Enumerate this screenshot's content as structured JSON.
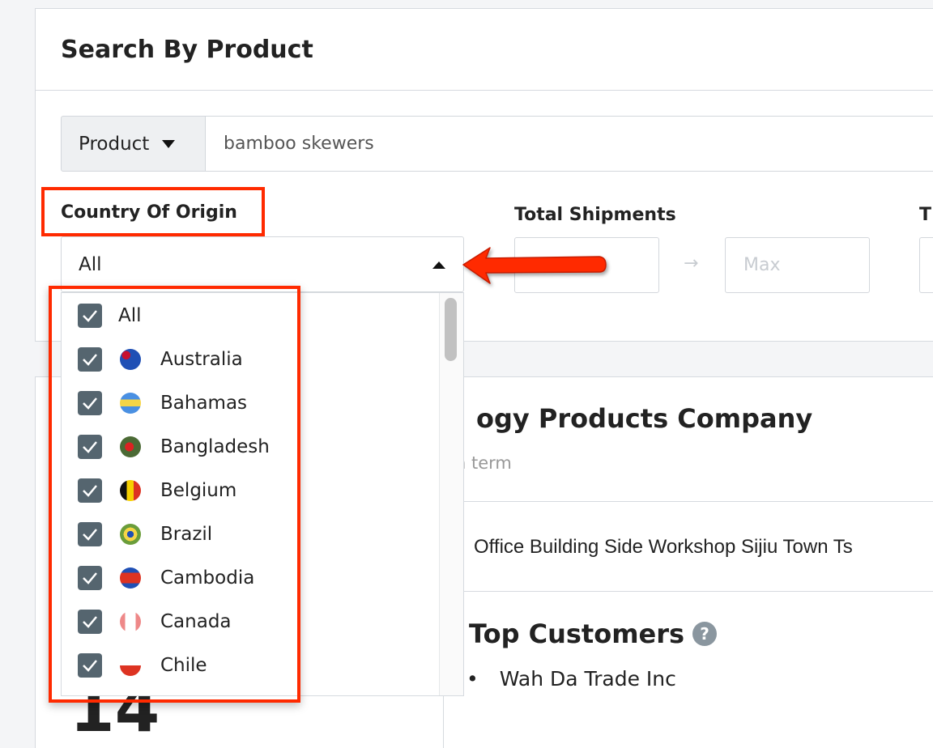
{
  "search_card": {
    "title": "Search By Product",
    "search_type": "Product",
    "query": "bamboo skewers"
  },
  "filters": {
    "country_label": "Country Of Origin",
    "country_value": "All",
    "shipments_label": "Total Shipments",
    "shipments_max_placeholder": "Max",
    "third_label_fragment": "T"
  },
  "country_options": [
    {
      "label": "All",
      "checked": true,
      "flag": null
    },
    {
      "label": "Australia",
      "checked": true,
      "flag": "australia-flag"
    },
    {
      "label": "Bahamas",
      "checked": true,
      "flag": "bahamas-flag"
    },
    {
      "label": "Bangladesh",
      "checked": true,
      "flag": "bangladesh-flag"
    },
    {
      "label": "Belgium",
      "checked": true,
      "flag": "belgium-flag"
    },
    {
      "label": "Brazil",
      "checked": true,
      "flag": "brazil-flag"
    },
    {
      "label": "Cambodia",
      "checked": true,
      "flag": "cambodia-flag"
    },
    {
      "label": "Canada",
      "checked": true,
      "flag": "canada-flag"
    },
    {
      "label": "Chile",
      "checked": true,
      "flag": "chile-flag"
    }
  ],
  "result": {
    "company_fragment": "ogy Products Company",
    "subtitle_fragment": "n term",
    "address_fragment": "Office Building Side Workshop Sijiu Town Ts",
    "top_customers_title": "Top Customers",
    "top_customers": [
      "Wah Da Trade Inc"
    ],
    "count_fragment": "14"
  },
  "colors": {
    "annotation": "#ff2a00",
    "checkbox": "#55656f"
  }
}
